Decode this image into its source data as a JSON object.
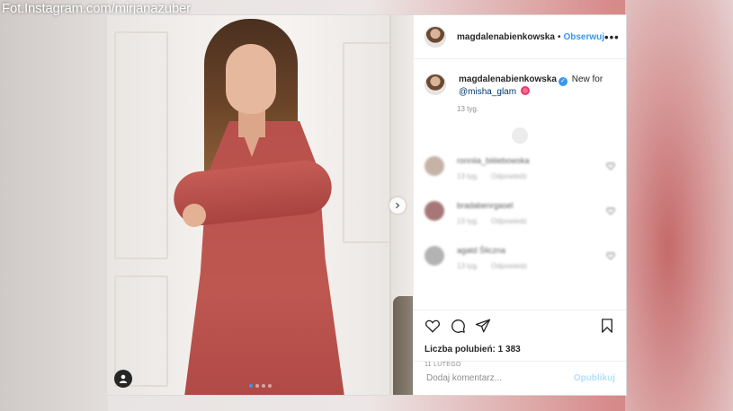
{
  "watermark": "Fot.Instagram.com/mirjanazuber",
  "colors": {
    "accent": "#3897f0",
    "mention": "#00376b",
    "muted": "#8e8e8e",
    "publish_disabled": "#b2dffc"
  },
  "post": {
    "header": {
      "username": "magdalenabienkowska",
      "separator": "•",
      "follow_label": "Obserwuj",
      "more_icon": "more-dots-icon"
    },
    "caption": {
      "username": "magdalenabienkowska",
      "text": "New for",
      "mention": "@misha_glam",
      "time": "13 tyg."
    },
    "comments": [
      {
        "user": "ronniia_biiiiebowska",
        "meta_time": "13 tyg.",
        "meta_action": "Odpowiedz",
        "avatar_color": "#b49a8c"
      },
      {
        "user": "bradabenrgasel",
        "meta_time": "13 tyg.",
        "meta_action": "Odpowiedz",
        "avatar_color": "#8a4a4a"
      },
      {
        "user": "agatd Śliczna",
        "meta_time": "13 tyg.",
        "meta_action": "Odpowiedz",
        "avatar_color": "#9a9a9a"
      }
    ],
    "actions": {
      "likes": "Liczba polubień: 1 383",
      "date": "11 LUTEGO"
    },
    "add_comment": {
      "placeholder": "Dodaj komentarz...",
      "publish_label": "Opublikuj"
    },
    "carousel": {
      "slides": 4,
      "active_slide": 1
    }
  }
}
